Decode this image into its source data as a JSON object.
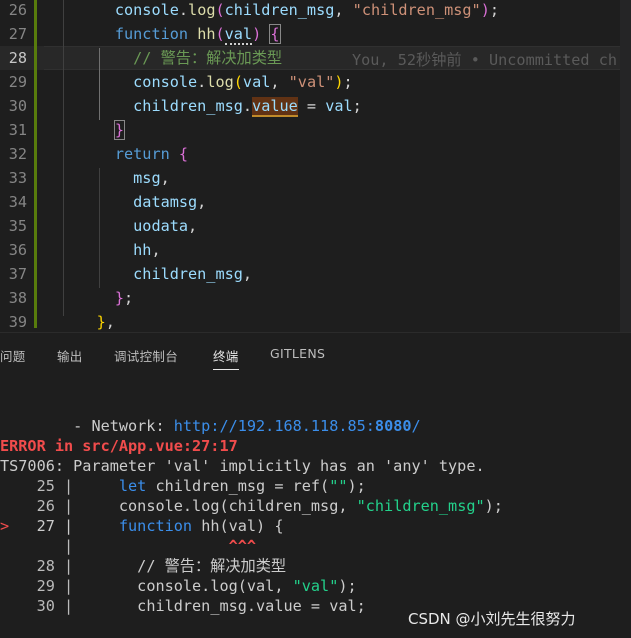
{
  "editor": {
    "lines": [
      {
        "n": "26",
        "segs": [
          [
            "      ",
            "pun"
          ],
          [
            "console",
            "var"
          ],
          [
            ".",
            "pun"
          ],
          [
            "log",
            "fn"
          ],
          [
            "(",
            "br2"
          ],
          [
            "children_msg",
            "var"
          ],
          [
            ", ",
            "pun"
          ],
          [
            "\"children_msg\"",
            "str"
          ],
          [
            ")",
            "br2"
          ],
          [
            ";",
            "pun"
          ]
        ]
      },
      {
        "n": "27",
        "segs": [
          [
            "      ",
            "pun"
          ],
          [
            "function",
            "kw"
          ],
          [
            " ",
            "pun"
          ],
          [
            "hh",
            "fn"
          ],
          [
            "(",
            "br2"
          ],
          [
            "val",
            "var"
          ],
          [
            ")",
            "br2"
          ],
          [
            " ",
            "pun"
          ],
          [
            "{",
            "br2"
          ]
        ]
      },
      {
        "n": "28",
        "segs": [
          [
            "        ",
            "pun"
          ],
          [
            "// 警告：解决加类型",
            "cm"
          ]
        ]
      },
      {
        "n": "29",
        "segs": [
          [
            "        ",
            "pun"
          ],
          [
            "console",
            "var"
          ],
          [
            ".",
            "pun"
          ],
          [
            "log",
            "fn"
          ],
          [
            "(",
            "br1"
          ],
          [
            "val",
            "var"
          ],
          [
            ", ",
            "pun"
          ],
          [
            "\"val\"",
            "str"
          ],
          [
            ")",
            "br1"
          ],
          [
            ";",
            "pun"
          ]
        ]
      },
      {
        "n": "30",
        "segs": [
          [
            "        ",
            "pun"
          ],
          [
            "children_msg",
            "var"
          ],
          [
            ".",
            "pun"
          ],
          [
            "value",
            "var"
          ],
          [
            " = ",
            "pun"
          ],
          [
            "val",
            "var"
          ],
          [
            ";",
            "pun"
          ]
        ]
      },
      {
        "n": "31",
        "segs": [
          [
            "      ",
            "pun"
          ],
          [
            "}",
            "br2"
          ]
        ]
      },
      {
        "n": "32",
        "segs": [
          [
            "      ",
            "pun"
          ],
          [
            "return",
            "kw"
          ],
          [
            " ",
            "pun"
          ],
          [
            "{",
            "br2"
          ]
        ]
      },
      {
        "n": "33",
        "segs": [
          [
            "        ",
            "pun"
          ],
          [
            "msg",
            "var"
          ],
          [
            ",",
            "pun"
          ]
        ]
      },
      {
        "n": "34",
        "segs": [
          [
            "        ",
            "pun"
          ],
          [
            "datamsg",
            "var"
          ],
          [
            ",",
            "pun"
          ]
        ]
      },
      {
        "n": "35",
        "segs": [
          [
            "        ",
            "pun"
          ],
          [
            "uodata",
            "var"
          ],
          [
            ",",
            "pun"
          ]
        ]
      },
      {
        "n": "36",
        "segs": [
          [
            "        ",
            "pun"
          ],
          [
            "hh",
            "var"
          ],
          [
            ",",
            "pun"
          ]
        ]
      },
      {
        "n": "37",
        "segs": [
          [
            "        ",
            "pun"
          ],
          [
            "children_msg",
            "var"
          ],
          [
            ",",
            "pun"
          ]
        ]
      },
      {
        "n": "38",
        "segs": [
          [
            "      ",
            "pun"
          ],
          [
            "}",
            "br2"
          ],
          [
            ";",
            "pun"
          ]
        ]
      },
      {
        "n": "39",
        "segs": [
          [
            "    ",
            "pun"
          ],
          [
            "}",
            "br1"
          ],
          [
            ",",
            "pun"
          ]
        ]
      }
    ],
    "blame": "You, 52秒钟前 • Uncommitted ch"
  },
  "panel": {
    "tabs": [
      "问题",
      "输出",
      "调试控制台",
      "终端",
      "GITLENS"
    ],
    "active_tab": "终端",
    "terminal": {
      "network_label": "  - Network: ",
      "network_url_prefix": "http://192.168.118.85:",
      "network_port": "8080",
      "network_url_suffix": "/",
      "error_title": "ERROR in src/App.vue:27:17",
      "error_message": "TS7006: Parameter 'val' implicitly has an 'any' type.",
      "code_lines": [
        {
          "marker": "  ",
          "n": "25",
          "segs": [
            [
              "    ",
              "p"
            ],
            [
              "let",
              "k"
            ],
            [
              " children_msg = ref(",
              "p"
            ],
            [
              "\"\"",
              "s"
            ],
            [
              ");",
              "p"
            ]
          ]
        },
        {
          "marker": "  ",
          "n": "26",
          "segs": [
            [
              "    console.log(children_msg, ",
              "p"
            ],
            [
              "\"children_msg\"",
              "s"
            ],
            [
              ");",
              "p"
            ]
          ]
        },
        {
          "marker": "> ",
          "n": "27",
          "segs": [
            [
              "    ",
              "p"
            ],
            [
              "function",
              "k"
            ],
            [
              " hh(val) {",
              "p"
            ]
          ]
        },
        {
          "marker": "  ",
          "n": "",
          "segs": [
            [
              "                ",
              "p"
            ],
            [
              "^^^",
              "c"
            ]
          ]
        },
        {
          "marker": "  ",
          "n": "28",
          "segs": [
            [
              "      // 警告：解决加类型",
              "p"
            ]
          ]
        },
        {
          "marker": "  ",
          "n": "29",
          "segs": [
            [
              "      console.log(val, ",
              "p"
            ],
            [
              "\"val\"",
              "s"
            ],
            [
              ");",
              "p"
            ]
          ]
        },
        {
          "marker": "  ",
          "n": "30",
          "segs": [
            [
              "      children_msg.value = val;",
              "p"
            ]
          ]
        }
      ]
    }
  },
  "watermark": "CSDN @小刘先生很努力"
}
